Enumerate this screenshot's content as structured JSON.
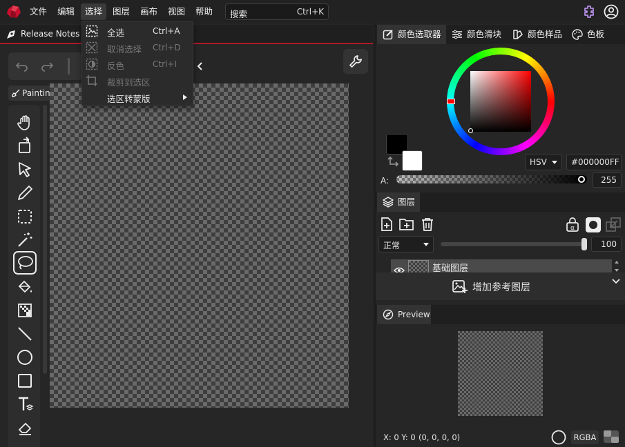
{
  "menu": {
    "items": [
      "文件",
      "编辑",
      "选择",
      "图层",
      "画布",
      "视图",
      "帮助"
    ],
    "active": "选择",
    "search_label": "搜索",
    "search_shortcut": "Ctrl+K"
  },
  "document_tab": {
    "title": "Release Notes 2"
  },
  "select_menu": {
    "items": [
      {
        "label": "全选",
        "shortcut": "Ctrl+A",
        "enabled": true,
        "icon": "select-all-icon"
      },
      {
        "label": "取消选择",
        "shortcut": "Ctrl+D",
        "enabled": false,
        "icon": "deselect-icon"
      },
      {
        "label": "反色",
        "shortcut": "Ctrl+I",
        "enabled": false,
        "icon": "invert-selection-icon"
      },
      {
        "label": "裁剪到选区",
        "shortcut": "",
        "enabled": false,
        "icon": "crop-icon"
      },
      {
        "label": "选区转蒙版",
        "shortcut": "",
        "enabled": true,
        "submenu": true
      }
    ]
  },
  "toolbar": {
    "painting_label": "Painting"
  },
  "tools": [
    "hand-icon",
    "rotate-icon",
    "pointer-icon",
    "pencil-icon",
    "rect-select-icon",
    "magic-wand-icon",
    "lasso-icon",
    "paint-bucket-icon",
    "gradient-icon",
    "line-icon",
    "ellipse-icon",
    "rectangle-icon",
    "text-icon",
    "eraser-icon"
  ],
  "selected_tool": "lasso-icon",
  "color_panel": {
    "tabs": [
      "颜色选取器",
      "颜色滑块",
      "颜色样品",
      "色板"
    ],
    "active_tab": "颜色选取器",
    "mode": "HSV",
    "hex": "#000000FF",
    "alpha_label": "A:",
    "alpha_value": "255",
    "primary_color": "#000000",
    "secondary_color": "#ffffff"
  },
  "layers_panel": {
    "tab": "图层",
    "blend_mode": "正常",
    "opacity": "100",
    "layer_name": "基础图层",
    "add_reference": "增加参考图层"
  },
  "preview_panel": {
    "tab": "Preview"
  },
  "status": {
    "xy": "X: 0 Y: 0",
    "rgba": "(0, 0, 0, 0)",
    "mode": "RGBA"
  },
  "colors": {
    "accent": "#b0182a",
    "brand": "#c8102e",
    "plugin": "#b48ee6"
  }
}
